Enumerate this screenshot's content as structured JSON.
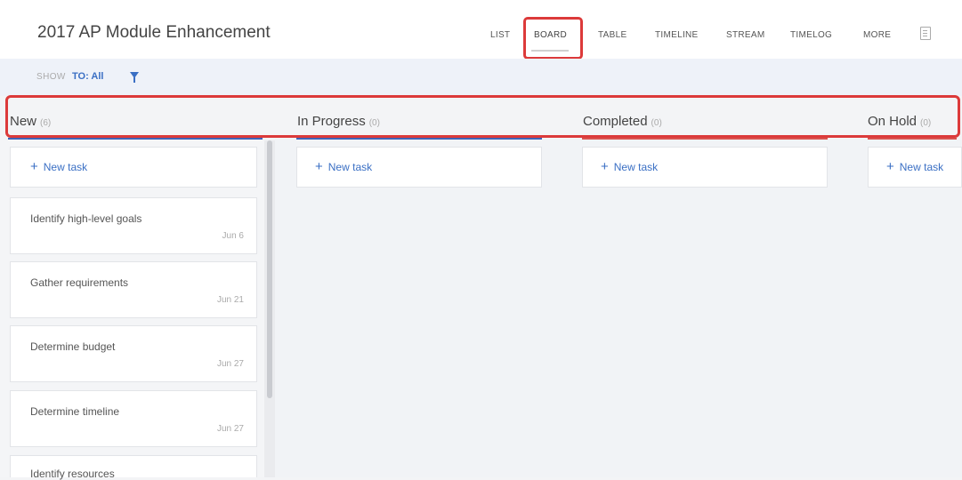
{
  "header": {
    "title": "2017 AP Module Enhancement",
    "tabs": [
      {
        "label": "LIST"
      },
      {
        "label": "BOARD",
        "active": true
      },
      {
        "label": "TABLE"
      },
      {
        "label": "TIMELINE"
      },
      {
        "label": "STREAM"
      },
      {
        "label": "TIMELOG"
      },
      {
        "label": "MORE"
      }
    ],
    "icons": [
      "document-icon"
    ]
  },
  "filter": {
    "show_label": "SHOW",
    "to_label": "TO: All",
    "icon": "filter-icon"
  },
  "columns": [
    {
      "title": "New",
      "count": "(6)",
      "accent": "#3f63b8"
    },
    {
      "title": "In Progress",
      "count": "(0)",
      "accent": "#3f63b8"
    },
    {
      "title": "Completed",
      "count": "(0)",
      "accent": "#d9534f"
    },
    {
      "title": "On Hold",
      "count": "(0)",
      "accent": "#d9534f"
    }
  ],
  "new_task_label": "New task",
  "tasks": [
    {
      "title": "Identify high-level goals",
      "date": "Jun 6"
    },
    {
      "title": "Gather requirements",
      "date": "Jun 21"
    },
    {
      "title": "Determine budget",
      "date": "Jun 27"
    },
    {
      "title": "Determine timeline",
      "date": "Jun 27"
    },
    {
      "title": "Identify resources",
      "date": ""
    }
  ],
  "colors": {
    "accent_blue": "#3a6fc4",
    "highlight_red": "#dc3a3a",
    "filter_bg": "#eef2f9"
  }
}
